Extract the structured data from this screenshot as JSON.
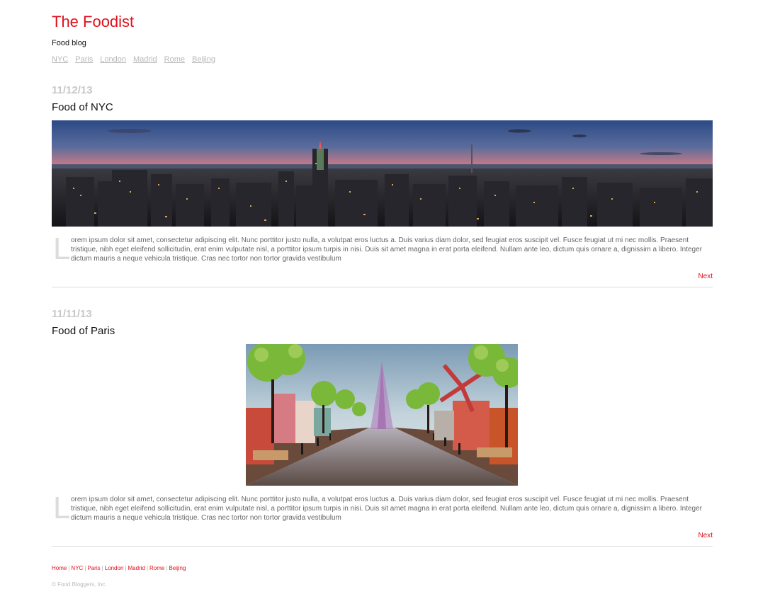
{
  "site": {
    "title": "The Foodist",
    "tagline": "Food blog"
  },
  "top_nav": [
    "NYC",
    "Paris",
    "London",
    "Madrid",
    "Rome",
    "Beijing"
  ],
  "posts": [
    {
      "date": "11/12/13",
      "title": "Food of NYC",
      "dropcap": "L",
      "body": "orem ipsum dolor sit amet, consectetur adipiscing elit. Nunc porttitor justo nulla, a volutpat eros luctus a. Duis varius diam dolor, sed feugiat eros suscipit vel. Fusce feugiat ut mi nec mollis. Praesent tristique, nibh eget eleifend sollicitudin, erat enim vulputate nisl, a porttitor ipsum turpis in nisi. Duis sit amet magna in erat porta eleifend. Nullam ante leo, dictum quis ornare a, dignissim a libero. Integer dictum mauris a neque vehicula tristique. Cras nec tortor non tortor gravida vestibulum",
      "next_label": "Next"
    },
    {
      "date": "11/11/13",
      "title": "Food of Paris",
      "dropcap": "L",
      "body": "orem ipsum dolor sit amet, consectetur adipiscing elit. Nunc porttitor justo nulla, a volutpat eros luctus a. Duis varius diam dolor, sed feugiat eros suscipit vel. Fusce feugiat ut mi nec mollis. Praesent tristique, nibh eget eleifend sollicitudin, erat enim vulputate nisl, a porttitor ipsum turpis in nisi. Duis sit amet magna in erat porta eleifend. Nullam ante leo, dictum quis ornare a, dignissim a libero. Integer dictum mauris a neque vehicula tristique. Cras nec tortor non tortor gravida vestibulum",
      "next_label": "Next"
    }
  ],
  "footer": {
    "nav": [
      "Home",
      "NYC",
      "Paris",
      "London",
      "Madrid",
      "Rome",
      "Beijing"
    ],
    "separator": "|",
    "copyright": "© Food Bloggers, Inc."
  },
  "colors": {
    "accent": "#e0101c",
    "muted": "#b8b8b8",
    "date": "#c8c8c8"
  }
}
